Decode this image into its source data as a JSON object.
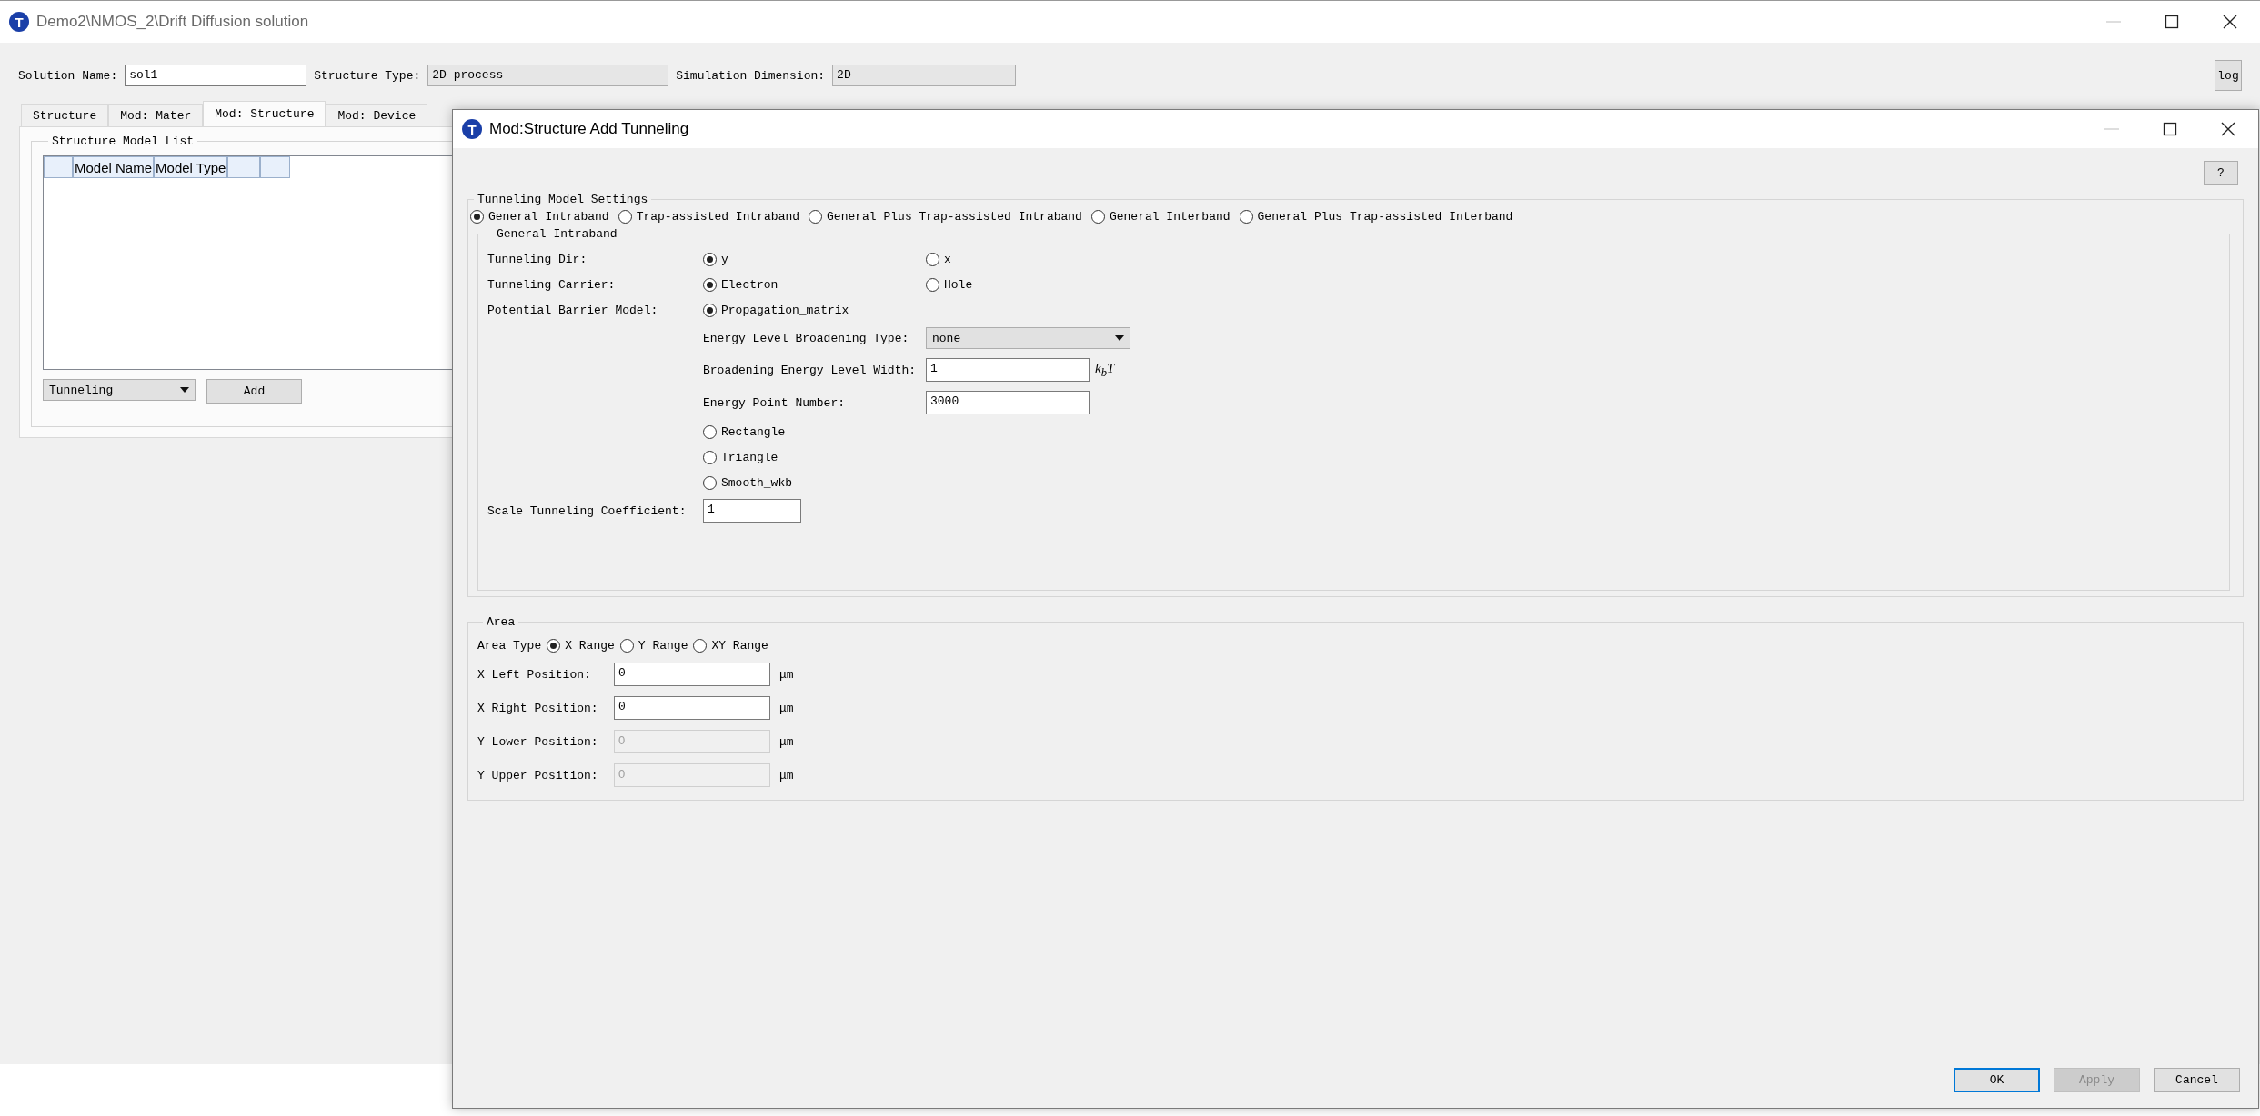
{
  "main_window": {
    "icon_letter": "T",
    "title": "Demo2\\NMOS_2\\Drift Diffusion solution",
    "solution_name": {
      "label": "Solution Name:",
      "value": "sol1"
    },
    "structure_type": {
      "label": "Structure Type:",
      "value": "2D process"
    },
    "simulation_dimension": {
      "label": "Simulation Dimension:",
      "value": "2D"
    },
    "log_button": "log",
    "tabs": [
      {
        "label": "Structure",
        "selected": false
      },
      {
        "label": "Mod: Mater",
        "selected": false
      },
      {
        "label": "Mod: Structure",
        "selected": true
      },
      {
        "label": "Mod: Device",
        "selected": false
      }
    ],
    "structure_model_list": {
      "title": "Structure Model List",
      "columns": [
        "Model Name",
        "Model Type"
      ]
    },
    "model_dropdown": "Tunneling",
    "add_button": "Add"
  },
  "dialog": {
    "icon_letter": "T",
    "title": "Mod:Structure Add Tunneling",
    "help_button": "?",
    "tunneling_model_settings": {
      "title": "Tunneling Model Settings",
      "options": [
        {
          "label": "General Intraband",
          "selected": true
        },
        {
          "label": "Trap-assisted Intraband",
          "selected": false
        },
        {
          "label": "General Plus Trap-assisted Intraband",
          "selected": false
        },
        {
          "label": "General Interband",
          "selected": false
        },
        {
          "label": "General Plus Trap-assisted Interband",
          "selected": false
        }
      ]
    },
    "general_intraband": {
      "title": "General Intraband",
      "tunneling_dir": {
        "label": "Tunneling Dir:",
        "options": [
          {
            "label": "y",
            "selected": true
          },
          {
            "label": "x",
            "selected": false
          }
        ]
      },
      "tunneling_carrier": {
        "label": "Tunneling Carrier:",
        "options": [
          {
            "label": "Electron",
            "selected": true
          },
          {
            "label": "Hole",
            "selected": false
          }
        ]
      },
      "potential_barrier_model": {
        "label": "Potential Barrier Model:",
        "options": [
          {
            "label": "Propagation_matrix",
            "selected": true
          },
          {
            "label": "Rectangle",
            "selected": false
          },
          {
            "label": "Triangle",
            "selected": false
          },
          {
            "label": "Smooth_wkb",
            "selected": false
          }
        ],
        "settings": [
          {
            "kind": "dropdown",
            "label": "Energy Level Broadening Type:",
            "value": "none"
          },
          {
            "kind": "field",
            "label": "Broadening Energy Level Width:",
            "value": "1",
            "unit": "k$_{b}$T"
          },
          {
            "kind": "field",
            "label": "Energy Point Number:",
            "value": "3000"
          }
        ]
      },
      "scale_tunneling_coefficient": {
        "label": "Scale Tunneling Coefficient:",
        "value": "1"
      }
    },
    "area": {
      "title": "Area",
      "type_label": "Area Type",
      "types": [
        {
          "label": "X Range",
          "selected": true
        },
        {
          "label": "Y Range",
          "selected": false
        },
        {
          "label": "XY Range",
          "selected": false
        }
      ],
      "positions": [
        {
          "label": "X Left Position:",
          "value": "0",
          "unit": "μm",
          "disabled": false
        },
        {
          "label": "X Right Position:",
          "value": "0",
          "unit": "μm",
          "disabled": false
        },
        {
          "label": "Y Lower Position:",
          "value": "0",
          "unit": "μm",
          "disabled": true
        },
        {
          "label": "Y Upper Position:",
          "value": "0",
          "unit": "μm",
          "disabled": true
        }
      ]
    },
    "buttons": [
      {
        "label": "OK",
        "default": true,
        "disabled": false
      },
      {
        "label": "Apply",
        "default": false,
        "disabled": true
      },
      {
        "label": "Cancel",
        "default": false,
        "disabled": false
      }
    ]
  }
}
